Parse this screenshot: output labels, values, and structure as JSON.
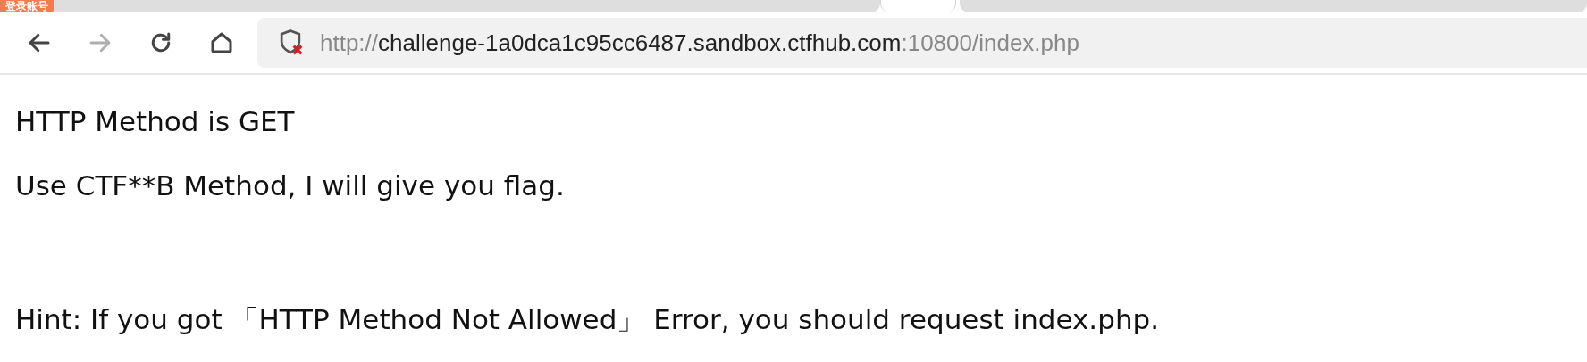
{
  "badge": "登录账号",
  "tabs": [
    {
      "selected": false
    },
    {
      "selected": true
    },
    {
      "selected": false
    }
  ],
  "nav": [
    {
      "kind": "back",
      "disabled": false
    },
    {
      "kind": "forward",
      "disabled": true
    },
    {
      "kind": "reload",
      "disabled": false
    },
    {
      "kind": "home",
      "disabled": false
    }
  ],
  "address_bar": {
    "secure": false,
    "scheme": "http://",
    "host": "challenge-1a0dca1c95cc6487.sandbox.ctfhub.com",
    "rest": ":10800/index.php"
  },
  "content": {
    "paragraphs": [
      "HTTP Method is GET",
      "Use CTF**B Method, I will give you flag."
    ],
    "hint": "Hint: If you got 「HTTP Method Not Allowed」 Error, you should request index.php."
  }
}
